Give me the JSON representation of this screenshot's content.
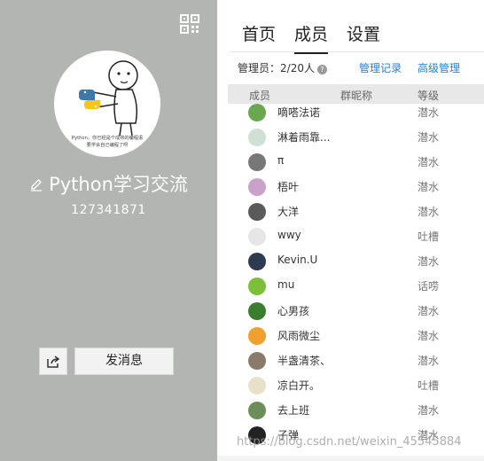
{
  "group": {
    "name": "Python学习交流",
    "id": "127341871",
    "avatar_caption_line1": "Python，你已经是个成熟的编程语",
    "avatar_caption_line2": "要学会自己编程了呀"
  },
  "actions": {
    "send_message": "发消息"
  },
  "tabs": [
    "首页",
    "成员",
    "设置"
  ],
  "admin": {
    "label": "管理员：",
    "count": "2/20人",
    "help": "?"
  },
  "links": {
    "manage_log": "管理记录",
    "advanced": "高级管理"
  },
  "table": {
    "headers": {
      "member": "成员",
      "nickname": "群昵称",
      "level": "等级"
    },
    "rows": [
      {
        "name": "嘀嗒法诺",
        "level": "潜水",
        "color": "#6aa84f"
      },
      {
        "name": "淋着雨靠...",
        "level": "潜水",
        "color": "#cfe0d4"
      },
      {
        "name": "π",
        "level": "潜水",
        "color": "#777777"
      },
      {
        "name": "梧叶",
        "level": "潜水",
        "color": "#c9a2c9"
      },
      {
        "name": "大洋",
        "level": "潜水",
        "color": "#5a5a5a"
      },
      {
        "name": "wwy",
        "level": "吐槽",
        "color": "#e6e6e6"
      },
      {
        "name": "Kevin.U",
        "level": "潜水",
        "color": "#2e3a4f"
      },
      {
        "name": "mu",
        "level": "话唠",
        "color": "#7cbf3a"
      },
      {
        "name": "心男孩",
        "level": "潜水",
        "color": "#3b7d2e"
      },
      {
        "name": "风雨微尘",
        "level": "潜水",
        "color": "#f0a030"
      },
      {
        "name": "半盏清茶、",
        "level": "潜水",
        "color": "#8a7a6a"
      },
      {
        "name": "凉白开。",
        "level": "吐槽",
        "color": "#e8e0c8"
      },
      {
        "name": "去上班",
        "level": "潜水",
        "color": "#6b8f5a"
      },
      {
        "name": "子弹",
        "level": "潜水",
        "color": "#222222"
      }
    ]
  },
  "watermark": "https://blog.csdn.net/weixin_45545884"
}
